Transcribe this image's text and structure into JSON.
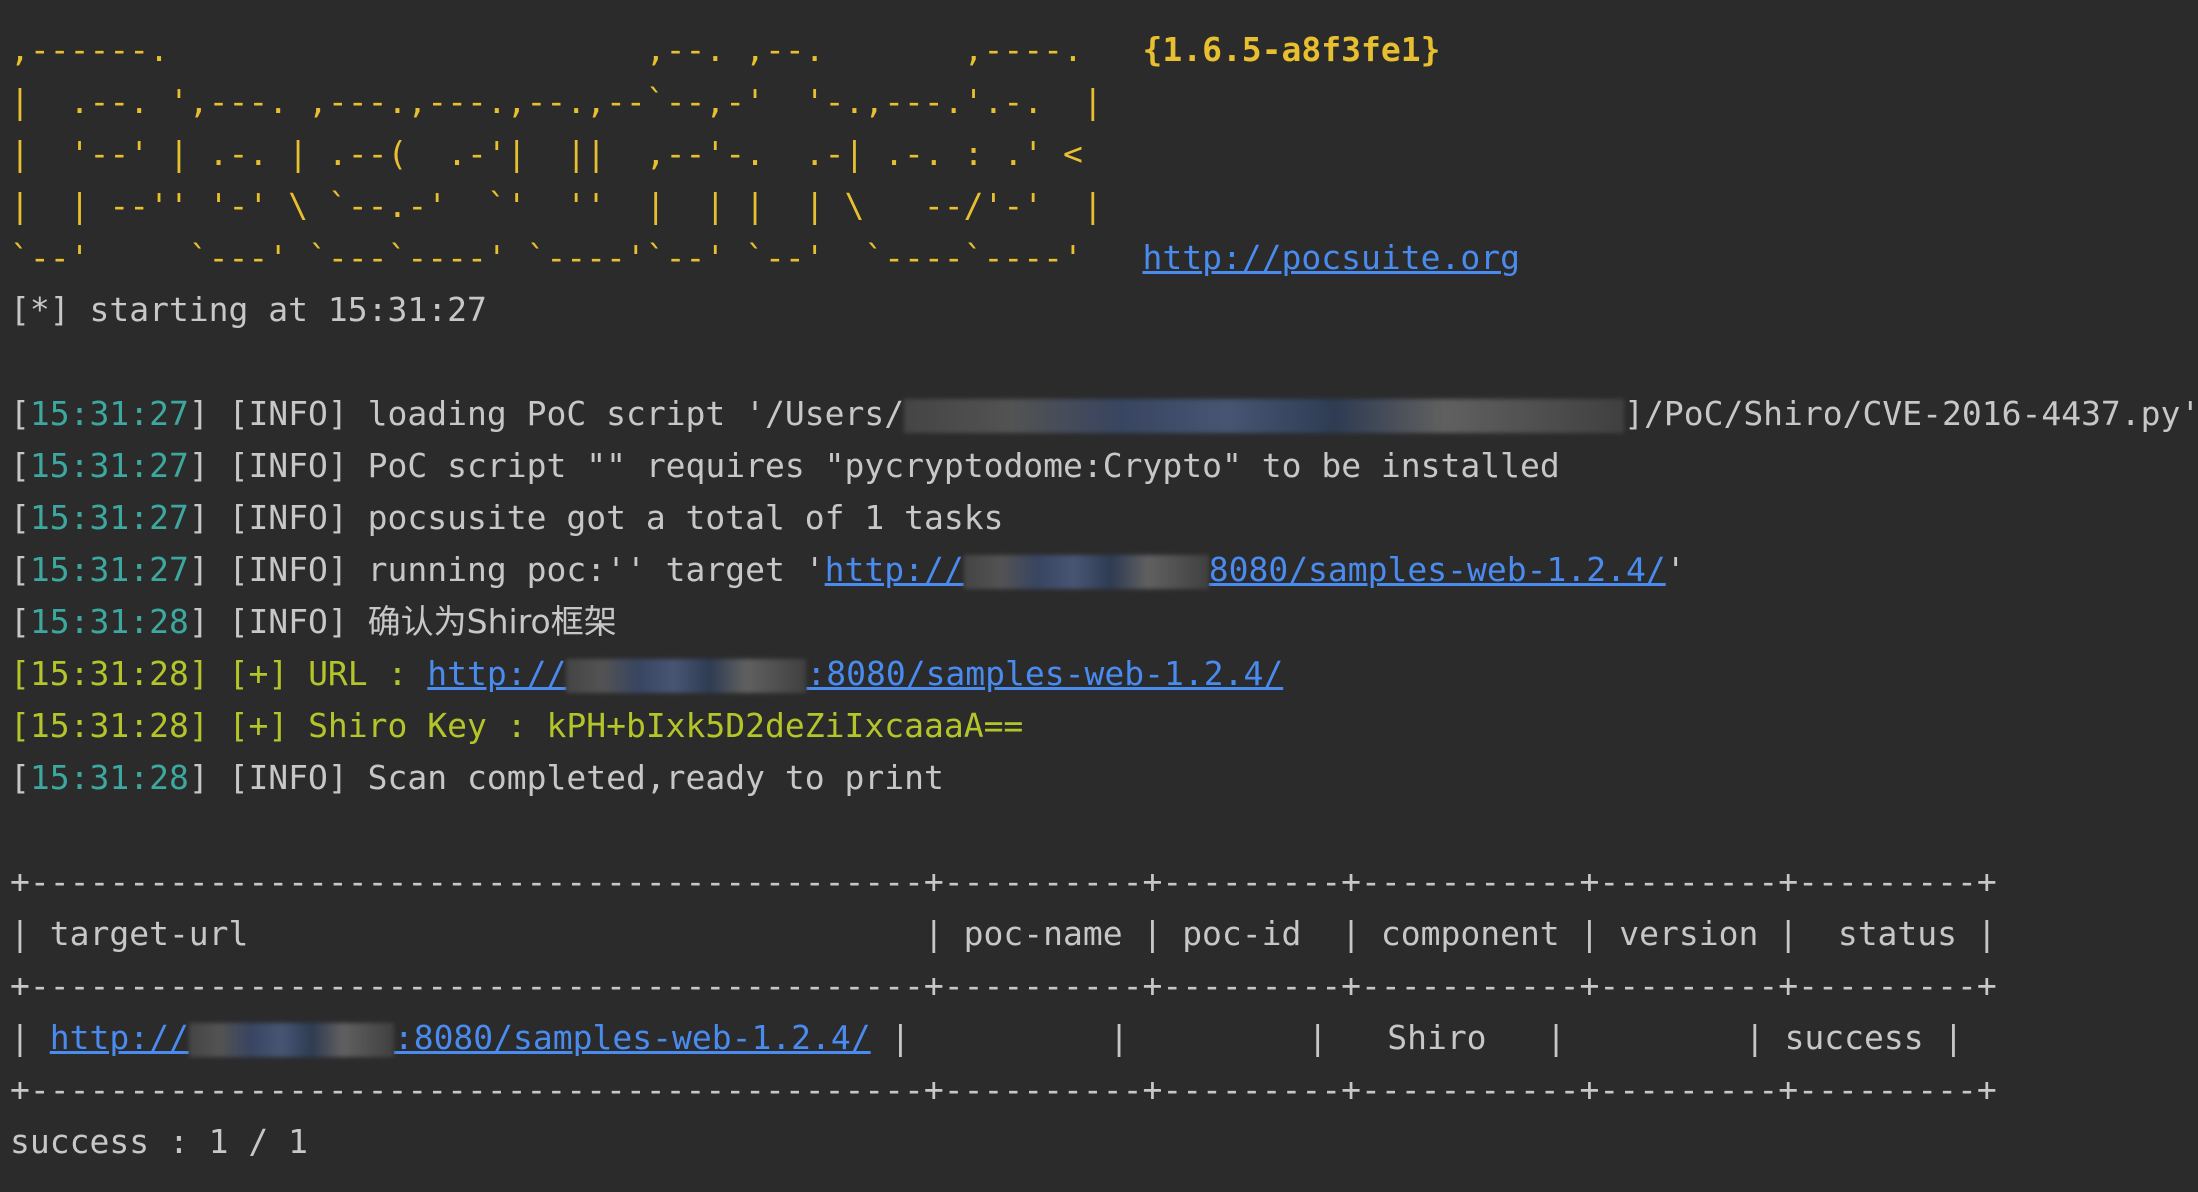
{
  "banner": {
    "line1": ",------.                        ,--. ,--.       ,----.   ",
    "line2": "|  .--. ',---. ,---.,---.,--.,--`--,-'  '-.,---.'.-.  |",
    "line3": "|  '--' | .-. | .--(  .-'|  ||  ,--'-.  .-| .-. : .' <",
    "line4": "|  | --'' '-' \\ `--.-'  `'  ''  |  | |  | \\   --/'-'  |",
    "line5": "`--'     `---' `---`----' `----'`--' `--'  `----`----'   ",
    "version": "{1.6.5-a8f3fe1}",
    "url": "http://pocsuite.org"
  },
  "start_line": "[*] starting at 15:31:27",
  "logs": [
    {
      "time": "15:31:27",
      "level": "INFO",
      "pre": "loading PoC script '/Users/",
      "post": "]/PoC/Shiro/CVE-2016-4437.py'"
    },
    {
      "time": "15:31:27",
      "level": "INFO",
      "msg": "PoC script \"\" requires \"pycryptodome:Crypto\" to be installed"
    },
    {
      "time": "15:31:27",
      "level": "INFO",
      "msg": "pocsusite got a total of 1 tasks"
    },
    {
      "time": "15:31:27",
      "level": "INFO",
      "pre": "running poc:'' target '",
      "link_pre": "http://",
      "link_post": "8080/samples-web-1.2.4/",
      "post": "'"
    },
    {
      "time": "15:31:28",
      "level": "INFO",
      "msg": "确认为Shiro框架"
    },
    {
      "time": "15:31:28",
      "level": "+",
      "pre": "URL : ",
      "link_pre": "http://",
      "link_post": ":8080/samples-web-1.2.4/"
    },
    {
      "time": "15:31:28",
      "level": "+",
      "msg": "Shiro Key : kPH+bIxk5D2deZiIxcaaaA=="
    },
    {
      "time": "15:31:28",
      "level": "INFO",
      "msg": "Scan completed,ready to print"
    }
  ],
  "table": {
    "border": "+---------------------------------------------+----------+---------+-----------+---------+---------+",
    "header": "| target-url                                  | poc-name | poc-id  | component | version |  status |",
    "row_open": "| ",
    "row_link_pre": "http://",
    "row_link_post": ":8080/samples-web-1.2.4/",
    "row_rest": " |          |         |   Shiro   |         | success |"
  },
  "summary": "success : 1 / 1",
  "colors": {
    "background": "#2b2b2b",
    "banner": "#e8bf2e",
    "timestamp": "#3ca89f",
    "success_line": "#b4c52a",
    "link": "#4a8bf0",
    "text": "#c7c7c7"
  }
}
